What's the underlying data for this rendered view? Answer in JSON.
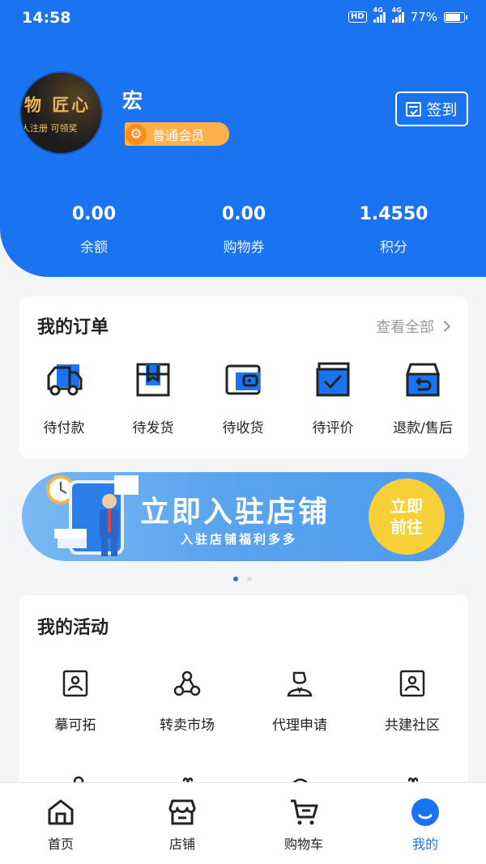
{
  "status_bar": {
    "time": "14:58",
    "hd": "HD",
    "net1": "4G",
    "net2": "4G",
    "battery": "77%"
  },
  "profile": {
    "avatar_text_1": "物 匠心",
    "avatar_text_2": "人注册 可领奖",
    "name": "宏",
    "member_level": "普通会员",
    "checkin_label": "签到"
  },
  "stats": [
    {
      "value": "0.00",
      "label": "余额"
    },
    {
      "value": "0.00",
      "label": "购物券"
    },
    {
      "value": "1.4550",
      "label": "积分"
    }
  ],
  "orders": {
    "title": "我的订单",
    "view_all": "查看全部",
    "items": [
      {
        "label": "待付款",
        "icon": "truck-icon"
      },
      {
        "label": "待发货",
        "icon": "package-icon"
      },
      {
        "label": "待收货",
        "icon": "wallet-icon"
      },
      {
        "label": "待评价",
        "icon": "check-box-icon"
      },
      {
        "label": "退款/售后",
        "icon": "return-box-icon"
      }
    ]
  },
  "banner": {
    "title": "立即入驻店铺",
    "subtitle": "入驻店铺福利多多",
    "cta_line1": "立即",
    "cta_line2": "前往"
  },
  "activities": {
    "title": "我的活动",
    "items": [
      {
        "label": "摹可拓",
        "icon": "contact-card-icon"
      },
      {
        "label": "转卖市场",
        "icon": "network-icon"
      },
      {
        "label": "代理申请",
        "icon": "agent-icon"
      },
      {
        "label": "共建社区",
        "icon": "contact-card-icon"
      }
    ]
  },
  "tabbar": {
    "items": [
      {
        "label": "首页",
        "icon": "home-icon"
      },
      {
        "label": "店铺",
        "icon": "store-icon"
      },
      {
        "label": "购物车",
        "icon": "cart-icon"
      },
      {
        "label": "我的",
        "icon": "profile-icon"
      }
    ],
    "active_index": 3
  },
  "colors": {
    "primary": "#1a73f0",
    "badge": "#ffb04a",
    "banner_cta": "#f7cf37"
  }
}
